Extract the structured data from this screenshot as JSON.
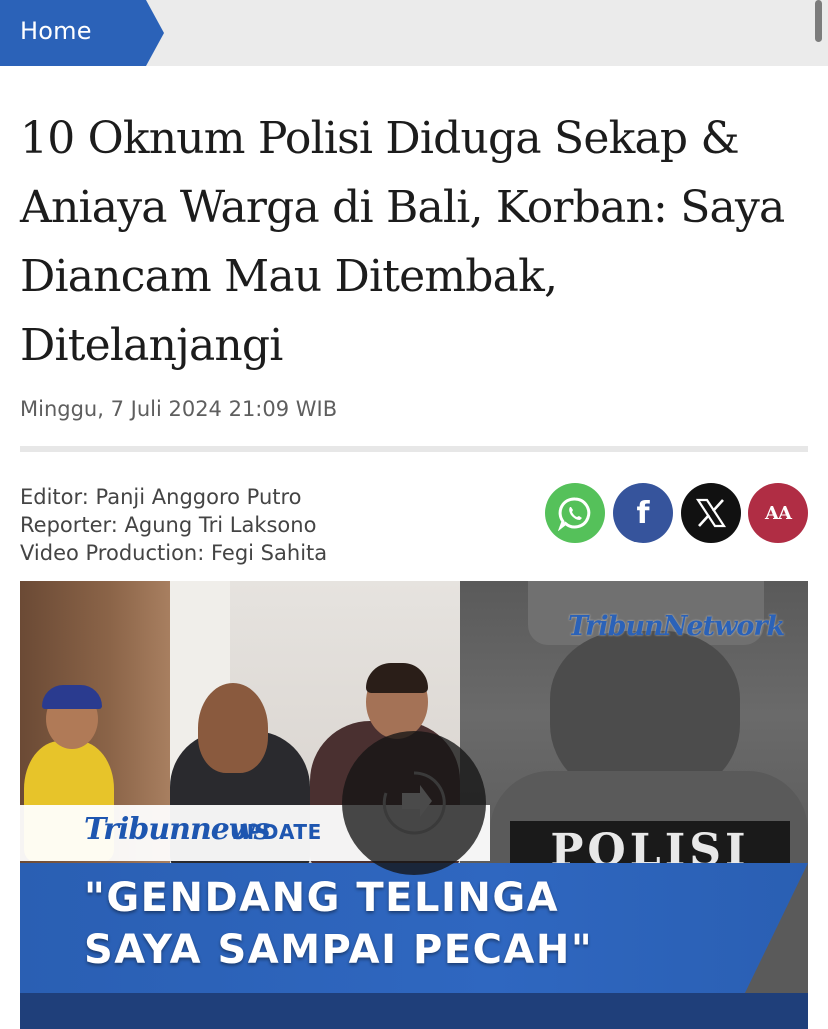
{
  "breadcrumb": {
    "home_label": "Home"
  },
  "article": {
    "title": "10 Oknum Polisi Diduga Sekap & Aniaya Warga di Bali, Korban: Saya Diancam Mau Ditembak, Ditelanjangi",
    "date": "Minggu, 7 Juli 2024 21:09 WIB",
    "credits": [
      "Editor: Panji Anggoro Putro",
      "Reporter: Agung Tri Laksono",
      "Video Production: Fegi Sahita"
    ]
  },
  "share": {
    "whatsapp_icon": "whatsapp-icon",
    "facebook_glyph": "f",
    "x_icon": "x-icon",
    "font_size_glyph": "AA",
    "colors": {
      "whatsapp": "#55c15a",
      "facebook": "#36549c",
      "x": "#111111",
      "font_size": "#b02d44"
    }
  },
  "video": {
    "watermark": "TribunNetwork",
    "brand": "Tribunnews",
    "update_label": "UPDATE",
    "badge_text": "POLISI",
    "quote_line_1": "\"GENDANG TELINGA",
    "quote_line_2": "SAYA SAMPAI PECAH\"",
    "play_icon": "play-icon"
  },
  "colors": {
    "breadcrumb": "#2b62b8",
    "quote_band": "#2f67c0"
  }
}
